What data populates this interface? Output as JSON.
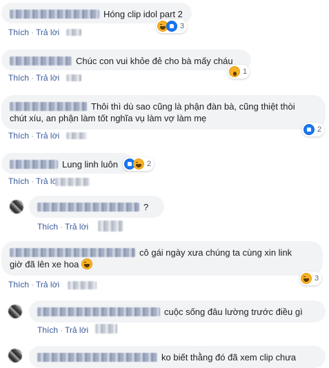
{
  "actions": {
    "like": "Thích",
    "reply": "Trả lời"
  },
  "comments": [
    {
      "text": "Hóng clip idol part 2",
      "reaction_count": "3"
    },
    {
      "text": "Chúc con vui khỏe đẻ cho bà mấy cháu",
      "reaction_count": "1"
    },
    {
      "text_line1": "Thôi thì dù sao cũng là phận đàn bà, cũng thiệt thòi",
      "text_line2": "chút xíu, an phận làm tốt nghĩa vụ làm vợ làm mẹ",
      "reaction_count": "2"
    },
    {
      "text": "Lung linh luôn",
      "reaction_count": "2"
    },
    {
      "text": "?"
    },
    {
      "text_line1": "cô gái ngày xưa chúng ta cùng xin link",
      "text_line2": "giờ đã lên xe hoa",
      "reaction_count": "3"
    },
    {
      "text": "cuộc sống đâu lường trước điều gì"
    },
    {
      "text": "ko biết thằng đó đã xem clip chưa"
    }
  ],
  "icons": [
    "haha-icon",
    "like-icon",
    "wow-icon",
    "avatar-icon"
  ],
  "colors": {
    "bubble": "#f2f3f5",
    "link": "#385898",
    "like_blue": "#1877f2",
    "haha_yellow": "#f7b125"
  }
}
